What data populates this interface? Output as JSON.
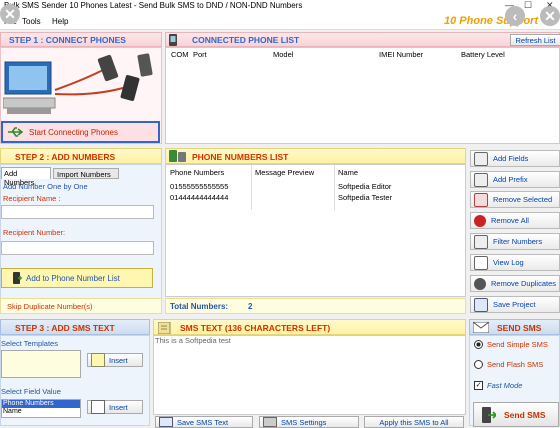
{
  "window": {
    "title": "Bulk SMS Sender 10 Phones Latest - Send Bulk SMS to DND / NON-DND Numbers",
    "brand": "10 Phone Support"
  },
  "menu": {
    "file": "File",
    "tools": "Tools",
    "help": "Help"
  },
  "step1": {
    "title": "STEP 1 : CONNECT PHONES",
    "connect_label": "Start Connecting Phones"
  },
  "connected": {
    "title": "CONNECTED PHONE LIST",
    "refresh_label": "Refresh List",
    "columns": [
      "COM",
      "Port",
      "Model",
      "IMEI Number",
      "Battery Level"
    ]
  },
  "step2": {
    "title": "STEP 2 : ADD NUMBERS",
    "tabs": [
      "Add Numbers",
      "Import Numbers"
    ],
    "section_label": "Add Number One by One",
    "recipient_name_label": "Recipient Name :",
    "recipient_number_label": "Recipient Number:",
    "recipient_name_value": "",
    "recipient_number_value": "",
    "add_label": "Add to Phone Number List",
    "skip_label": "Skip Duplicate Number(s)"
  },
  "numbers": {
    "title": "PHONE NUMBERS LIST",
    "columns": [
      "Phone Numbers",
      "Message Preview",
      "Name"
    ],
    "rows": [
      {
        "phone": "01555555555555",
        "preview": "",
        "name": "Softpedia Editor"
      },
      {
        "phone": "01444444444444",
        "preview": "",
        "name": "Softpedia Tester"
      }
    ],
    "total_label": "Total Numbers:",
    "total_value": "2"
  },
  "actions": {
    "add_fields": "Add Fields",
    "add_prefix": "Add Prefix",
    "remove_selected": "Remove Selected",
    "remove_all": "Remove All",
    "filter_numbers": "Filter Numbers",
    "view_log": "View Log",
    "remove_duplicates": "Remove Duplicates",
    "save_project": "Save Project"
  },
  "step3": {
    "title": "STEP 3 : ADD SMS TEXT",
    "templates_label": "Select Templates",
    "insert_label": "Insert",
    "field_value_label": "Select Field Value",
    "field_options": [
      "Phone Numbers",
      "Name"
    ],
    "insert2_label": "Insert"
  },
  "sms": {
    "title": "SMS TEXT (136 CHARACTERS LEFT)",
    "text": "This is a Softpedia test",
    "save_label": "Save SMS Text",
    "settings_label": "SMS Settings",
    "apply_label": "Apply this SMS to All"
  },
  "send": {
    "title": "SEND SMS",
    "simple_label": "Send Simple SMS",
    "flash_label": "Send Flash SMS",
    "fast_label": "Fast Mode",
    "send_label": "Send SMS"
  }
}
